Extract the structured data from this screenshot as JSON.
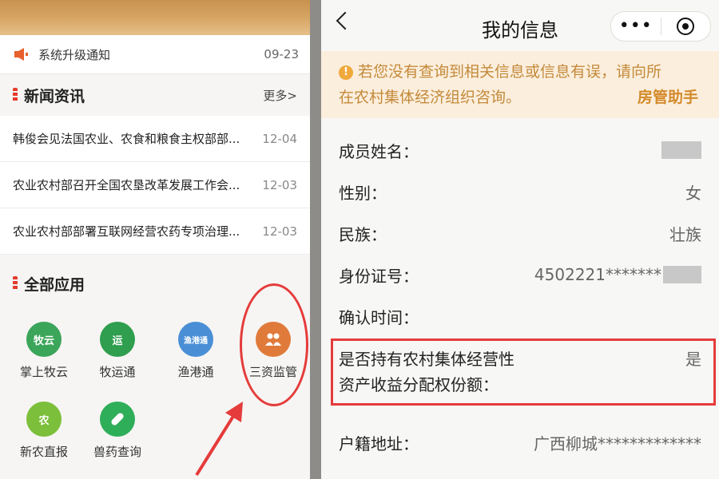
{
  "left": {
    "notice": {
      "text": "系统升级通知",
      "date": "09-23"
    },
    "news": {
      "title": "新闻资讯",
      "more": "更多>",
      "items": [
        {
          "title": "韩俊会见法国农业、农食和粮食主权部部...",
          "date": "12-04"
        },
        {
          "title": "农业农村部召开全国农垦改革发展工作会...",
          "date": "12-03"
        },
        {
          "title": "农业农村部部署互联网经营农药专项治理...",
          "date": "12-03"
        }
      ]
    },
    "apps": {
      "title": "全部应用",
      "items": [
        {
          "label": "掌上牧云",
          "icon": "牧云",
          "color": "#3ba55a"
        },
        {
          "label": "牧运通",
          "icon": "运",
          "color": "#2f9e4e"
        },
        {
          "label": "渔港通",
          "icon": "渔港通",
          "color": "#4a8fd6"
        },
        {
          "label": "三资监管",
          "icon": "人",
          "color": "#e07a3b"
        },
        {
          "label": "新农直报",
          "icon": "农",
          "color": "#7cbf3a"
        },
        {
          "label": "兽药查询",
          "icon": "药",
          "color": "#2fae5a"
        }
      ]
    }
  },
  "right": {
    "title": "我的信息",
    "warning": {
      "text_line1": "若您没有查询到相关信息或信息有误，请向所",
      "text_line2": "在农村集体经济组织咨询。",
      "link": "房管助手"
    },
    "fields": {
      "name_label": "成员姓名：",
      "gender_label": "性别：",
      "gender_value": "女",
      "ethnicity_label": "民族：",
      "ethnicity_value": "壮族",
      "id_label": "身份证号：",
      "id_value": "4502221*******",
      "confirm_label": "确认时间：",
      "share_label_line1": "是否持有农村集体经营性",
      "share_label_line2": "资产收益分配权份额：",
      "share_value": "是",
      "address_label": "户籍地址：",
      "address_value": "广西柳城*************"
    }
  },
  "colors": {
    "highlight": "#e53b3b",
    "warning_bg": "#fbeedd",
    "warning_text": "#c48a3a"
  }
}
